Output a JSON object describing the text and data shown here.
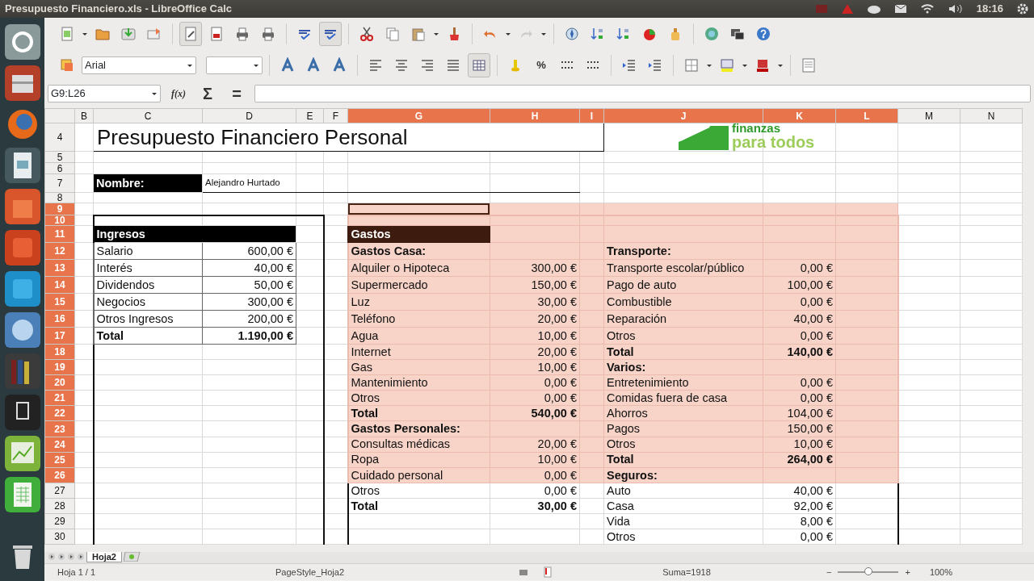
{
  "window": {
    "title": "Presupuesto Financiero.xls - LibreOffice Calc"
  },
  "panel": {
    "time": "18:16"
  },
  "formatting": {
    "font_name": "Arial",
    "percent_symbol": "%"
  },
  "formula_bar": {
    "name_box": "G9:L26",
    "function_symbol": "f(x)",
    "sum_symbol": "Σ",
    "equals_symbol": "="
  },
  "logo": {
    "line1": "finanzas",
    "line2": "para todos"
  },
  "columns": [
    {
      "label": "B",
      "selected": false
    },
    {
      "label": "C",
      "selected": false
    },
    {
      "label": "D",
      "selected": false
    },
    {
      "label": "E",
      "selected": false
    },
    {
      "label": "F",
      "selected": false
    },
    {
      "label": "G",
      "selected": true
    },
    {
      "label": "H",
      "selected": true
    },
    {
      "label": "I",
      "selected": true
    },
    {
      "label": "J",
      "selected": true
    },
    {
      "label": "K",
      "selected": true
    },
    {
      "label": "L",
      "selected": true
    },
    {
      "label": "M",
      "selected": false
    },
    {
      "label": "N",
      "selected": false
    }
  ],
  "rows": [
    {
      "label": "4",
      "selected": false,
      "left": {
        "kind": "title",
        "label": "Presupuesto Financiero Personal"
      }
    },
    {
      "label": "5",
      "selected": false
    },
    {
      "label": "6",
      "selected": false
    },
    {
      "label": "7",
      "selected": false,
      "left": {
        "kind": "name",
        "label": "Nombre:",
        "value": "Alejandro Hurtado"
      }
    },
    {
      "label": "8",
      "selected": false
    },
    {
      "label": "9",
      "selected": true
    },
    {
      "label": "10",
      "selected": true
    },
    {
      "label": "11",
      "selected": true,
      "left": {
        "kind": "banner",
        "label": "Ingresos"
      },
      "middle": {
        "kind": "banner",
        "label": "Gastos"
      }
    },
    {
      "label": "12",
      "selected": true,
      "left": {
        "kind": "item",
        "label": "Salario",
        "amount": "600,00 €"
      },
      "middle": {
        "kind": "heading",
        "label": "Gastos Casa:"
      },
      "right": {
        "kind": "heading",
        "label": "Transporte:"
      }
    },
    {
      "label": "13",
      "selected": true,
      "left": {
        "kind": "item",
        "label": "Interés",
        "amount": "40,00 €"
      },
      "middle": {
        "kind": "item",
        "label": "Alquiler o Hipoteca",
        "amount": "300,00 €"
      },
      "right": {
        "kind": "item",
        "label": "Transporte escolar/público",
        "amount": "0,00 €"
      }
    },
    {
      "label": "14",
      "selected": true,
      "left": {
        "kind": "item",
        "label": "Dividendos",
        "amount": "50,00 €"
      },
      "middle": {
        "kind": "item",
        "label": "Supermercado",
        "amount": "150,00 €"
      },
      "right": {
        "kind": "item",
        "label": "Pago de auto",
        "amount": "100,00 €"
      }
    },
    {
      "label": "15",
      "selected": true,
      "left": {
        "kind": "item",
        "label": "Negocios",
        "amount": "300,00 €"
      },
      "middle": {
        "kind": "item",
        "label": "Luz",
        "amount": "30,00 €"
      },
      "right": {
        "kind": "item",
        "label": "Combustible",
        "amount": "0,00 €"
      }
    },
    {
      "label": "16",
      "selected": true,
      "left": {
        "kind": "item",
        "label": "Otros Ingresos",
        "amount": "200,00 €"
      },
      "middle": {
        "kind": "item",
        "label": "Teléfono",
        "amount": "20,00 €"
      },
      "right": {
        "kind": "item",
        "label": "Reparación",
        "amount": "40,00 €"
      }
    },
    {
      "label": "17",
      "selected": true,
      "left": {
        "kind": "total",
        "label": "Total",
        "amount": "1.190,00 €"
      },
      "middle": {
        "kind": "item",
        "label": "Agua",
        "amount": "10,00 €"
      },
      "right": {
        "kind": "item",
        "label": "Otros",
        "amount": "0,00 €"
      }
    },
    {
      "label": "18",
      "selected": true,
      "middle": {
        "kind": "item",
        "label": "Internet",
        "amount": "20,00 €"
      },
      "right": {
        "kind": "total",
        "label": "Total",
        "amount": "140,00 €"
      }
    },
    {
      "label": "19",
      "selected": true,
      "middle": {
        "kind": "item",
        "label": "Gas",
        "amount": "10,00 €"
      },
      "right": {
        "kind": "heading",
        "label": "Varios:"
      }
    },
    {
      "label": "20",
      "selected": true,
      "middle": {
        "kind": "item",
        "label": "Mantenimiento",
        "amount": "0,00 €"
      },
      "right": {
        "kind": "item",
        "label": "Entretenimiento",
        "amount": "0,00 €"
      }
    },
    {
      "label": "21",
      "selected": true,
      "middle": {
        "kind": "item",
        "label": "Otros",
        "amount": "0,00 €"
      },
      "right": {
        "kind": "item",
        "label": "Comidas fuera de casa",
        "amount": "0,00 €"
      }
    },
    {
      "label": "22",
      "selected": true,
      "middle": {
        "kind": "total",
        "label": "Total",
        "amount": "540,00 €"
      },
      "right": {
        "kind": "item",
        "label": "Ahorros",
        "amount": "104,00 €"
      }
    },
    {
      "label": "23",
      "selected": true,
      "middle": {
        "kind": "heading",
        "label": "Gastos Personales:"
      },
      "right": {
        "kind": "item",
        "label": "Pagos",
        "amount": "150,00 €"
      }
    },
    {
      "label": "24",
      "selected": true,
      "middle": {
        "kind": "item",
        "label": "Consultas médicas",
        "amount": "20,00 €"
      },
      "right": {
        "kind": "item",
        "label": "Otros",
        "amount": "10,00 €"
      }
    },
    {
      "label": "25",
      "selected": true,
      "middle": {
        "kind": "item",
        "label": "Ropa",
        "amount": "10,00 €"
      },
      "right": {
        "kind": "total",
        "label": "Total",
        "amount": "264,00 €"
      }
    },
    {
      "label": "26",
      "selected": true,
      "middle": {
        "kind": "item",
        "label": "Cuidado personal",
        "amount": "0,00 €"
      },
      "right": {
        "kind": "heading",
        "label": "Seguros:"
      }
    },
    {
      "label": "27",
      "selected": false,
      "middle": {
        "kind": "item",
        "label": "Otros",
        "amount": "0,00 €"
      },
      "right": {
        "kind": "item",
        "label": "Auto",
        "amount": "40,00 €"
      }
    },
    {
      "label": "28",
      "selected": false,
      "middle": {
        "kind": "total",
        "label": "Total",
        "amount": "30,00 €"
      },
      "right": {
        "kind": "item",
        "label": "Casa",
        "amount": "92,00 €"
      }
    },
    {
      "label": "29",
      "selected": false,
      "right": {
        "kind": "item",
        "label": "Vida",
        "amount": "8,00 €"
      }
    },
    {
      "label": "30",
      "selected": false,
      "right": {
        "kind": "item",
        "label": "Otros",
        "amount": "0,00 €"
      }
    }
  ],
  "sheet_tabs": [
    {
      "label": "Hoja2",
      "selected": true
    }
  ],
  "status_bar": {
    "sheet": "Hoja 1 / 1",
    "page_style": "PageStyle_Hoja2",
    "sum": "Suma=1918",
    "zoom_minus": "−",
    "zoom_plus": "+",
    "zoom": {
      "level": 0.5
    },
    "zoom_percent": "100%"
  }
}
